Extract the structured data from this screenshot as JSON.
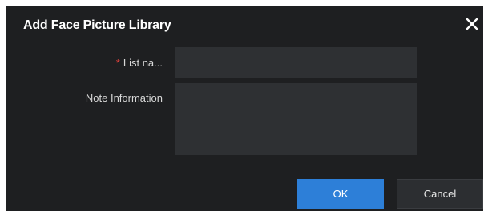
{
  "dialog": {
    "title": "Add Face Picture Library",
    "close_icon": "close-icon"
  },
  "form": {
    "list_name": {
      "required_mark": "*",
      "label": "List na...",
      "value": "",
      "placeholder": ""
    },
    "note_information": {
      "label": "Note Information",
      "value": "",
      "placeholder": ""
    }
  },
  "buttons": {
    "ok_label": "OK",
    "cancel_label": "Cancel"
  },
  "colors": {
    "dialog_bg": "#1e1f21",
    "input_bg": "#2e3033",
    "primary": "#2d7fd8",
    "required": "#e0413d"
  }
}
